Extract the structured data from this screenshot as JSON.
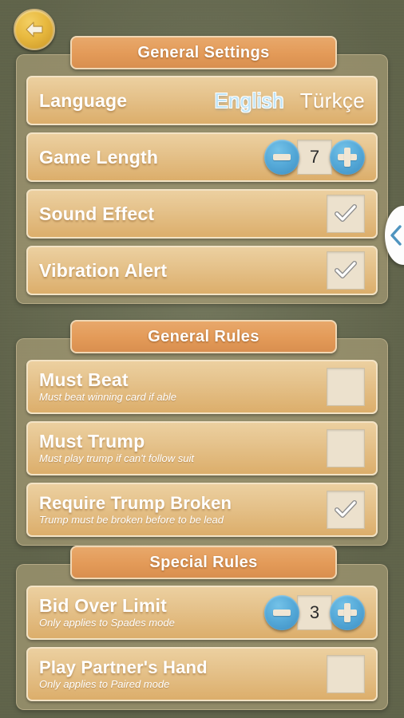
{
  "nav": {
    "back_icon": "arrow-left-icon",
    "edge_tab_icon": "chevron-left-icon"
  },
  "colors": {
    "page_background": "#6b6f53",
    "panel": "#b0a37a",
    "row_light": "#ecd0a0",
    "row_dark": "#dcae6b",
    "header_pill": "#e39a58",
    "accent_blue": "#55a9d8",
    "selected_language": "#bfe4f7",
    "checkbox_fill": "#ece1cd",
    "back_button": "#e8b93f"
  },
  "sections": [
    {
      "title": "General Settings",
      "rows": [
        {
          "id": "language",
          "type": "language",
          "title": "Language",
          "subtitle": "",
          "options": [
            {
              "label": "English",
              "selected": true
            },
            {
              "label": "Türkçe",
              "selected": false
            }
          ]
        },
        {
          "id": "game-length",
          "type": "stepper",
          "title": "Game Length",
          "subtitle": "",
          "value": "7",
          "minus_label": "−",
          "plus_label": "+"
        },
        {
          "id": "sound-effect",
          "type": "checkbox",
          "title": "Sound Effect",
          "subtitle": "",
          "checked": true
        },
        {
          "id": "vibration-alert",
          "type": "checkbox",
          "title": "Vibration Alert",
          "subtitle": "",
          "checked": true
        }
      ]
    },
    {
      "title": "General Rules",
      "rows": [
        {
          "id": "must-beat",
          "type": "checkbox",
          "title": "Must Beat",
          "subtitle": "Must beat winning card if able",
          "checked": false
        },
        {
          "id": "must-trump",
          "type": "checkbox",
          "title": "Must Trump",
          "subtitle": "Must play trump if can't follow suit",
          "checked": false
        },
        {
          "id": "require-trump-broken",
          "type": "checkbox",
          "title": "Require Trump Broken",
          "subtitle": "Trump must be broken before to be lead",
          "checked": true
        }
      ]
    },
    {
      "title": "Special Rules",
      "rows": [
        {
          "id": "bid-over-limit",
          "type": "stepper",
          "title": "Bid Over Limit",
          "subtitle": "Only applies to Spades mode",
          "value": "3",
          "minus_label": "−",
          "plus_label": "+"
        },
        {
          "id": "play-partners-hand",
          "type": "checkbox",
          "title": "Play Partner's Hand",
          "subtitle": "Only applies to Paired mode",
          "checked": false
        }
      ]
    }
  ]
}
